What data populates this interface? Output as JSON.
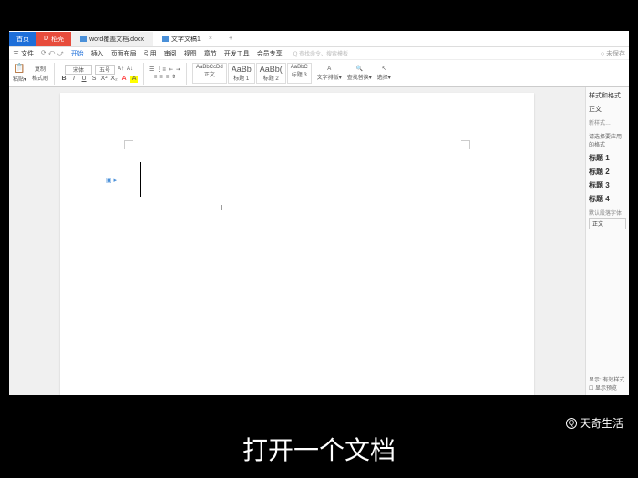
{
  "tabs": {
    "home": "首页",
    "d": "稻壳",
    "doc1": "word覆盖文档.docx",
    "active": "文字文稿1",
    "plus": "+"
  },
  "menu": {
    "file": "三 文件",
    "items": [
      "开始",
      "插入",
      "页面布局",
      "引用",
      "审阅",
      "视图",
      "章节",
      "开发工具",
      "会员专享"
    ],
    "search_ph": "Q 查找命令、搜索模板",
    "share": "○ 未保存"
  },
  "ribbon": {
    "paste": "粘贴▾",
    "copy": "复制",
    "fmt": "格式刷",
    "font": "宋体",
    "size": "五号",
    "bold": "B",
    "italic": "I",
    "underline": "U",
    "strike": "S",
    "styles": {
      "s1": "AaBbCcDd",
      "s2": "AaBb",
      "s3": "AaBb(",
      "s4": "AaBbC",
      "l1": "正文",
      "l2": "标题 1",
      "l3": "标题 2",
      "l4": "标题 3"
    },
    "stylebtn": "文字排版▾",
    "findbtn": "查找替换▾",
    "selbtn": "选择▾"
  },
  "panel": {
    "title": "样式和格式",
    "body": "正文",
    "newstyle": "新样式…",
    "apply": "请选择要应用的格式",
    "h1": "标题 1",
    "h2": "标题 2",
    "h3": "标题 3",
    "h4": "标题 4",
    "def": "默认段落字体",
    "bodytext": "正文",
    "show": "显示: 有效样式",
    "showfmt": "☐ 显示预览"
  },
  "page_content": "I",
  "caption": "打开一个文档",
  "watermark": "天奇生活"
}
